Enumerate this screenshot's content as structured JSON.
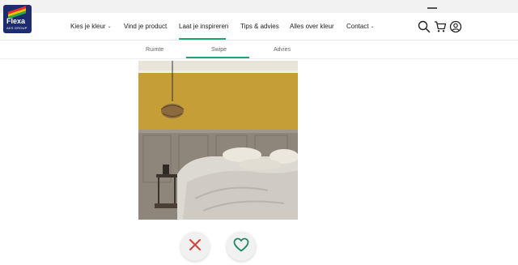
{
  "brand": {
    "logo_text": "Flexa",
    "logo_sub": "AKS GROUP"
  },
  "nav": {
    "items": [
      {
        "label": "Kies je kleur",
        "has_dropdown": true
      },
      {
        "label": "Vind je product",
        "has_dropdown": false
      },
      {
        "label": "Laat je inspireren",
        "has_dropdown": false,
        "active": true
      },
      {
        "label": "Tips & advies",
        "has_dropdown": false
      },
      {
        "label": "Alles over kleur",
        "has_dropdown": false
      },
      {
        "label": "Contact",
        "has_dropdown": true
      }
    ],
    "dropdown_glyph": "⌄"
  },
  "header_icons": [
    "search-icon",
    "cart-icon",
    "account-icon"
  ],
  "subnav": {
    "tabs": [
      {
        "label": "Ruimte",
        "active": false
      },
      {
        "label": "Swipe",
        "active": true
      },
      {
        "label": "Advies",
        "active": false
      }
    ]
  },
  "swipe": {
    "image": "bedroom with ochre yellow wall and grey wood panelling",
    "dislike_icon": "close-icon",
    "like_icon": "heart-icon"
  },
  "colors": {
    "accent": "#1aa871",
    "brand_navy": "#1d2c6e",
    "wall_ochre": "#c7a23e",
    "panel_grey": "#8b8278",
    "dislike": "#d2443b",
    "like": "#1d8a63"
  }
}
